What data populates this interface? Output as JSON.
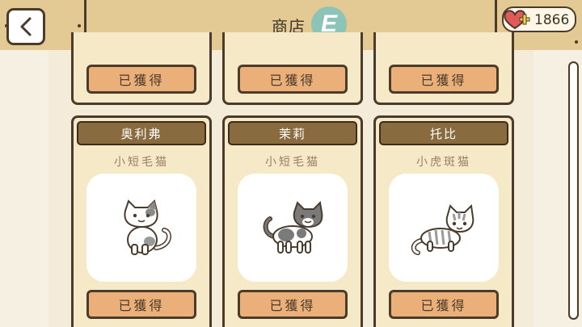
{
  "header": {
    "title": "商店",
    "badge_letter": "E",
    "currency_amount": "1866"
  },
  "top_cards": [
    {
      "button_label": "已獲得"
    },
    {
      "button_label": "已獲得"
    },
    {
      "button_label": "已獲得"
    }
  ],
  "cats": [
    {
      "name": "奥利弗",
      "breed": "小短毛猫",
      "button_label": "已獲得"
    },
    {
      "name": "茉莉",
      "breed": "小短毛猫",
      "button_label": "已獲得"
    },
    {
      "name": "托比",
      "breed": "小虎斑猫",
      "button_label": "已獲得"
    }
  ],
  "colors": {
    "wood": "#e3c994",
    "outline": "#4a3b2b",
    "button": "#ebaf79",
    "name_plate": "#8a6a3f",
    "badge": "#8cc4b8"
  }
}
